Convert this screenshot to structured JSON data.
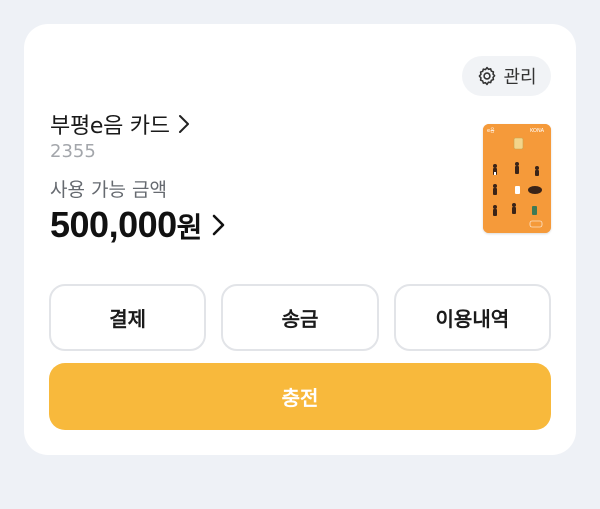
{
  "card": {
    "manage_label": "관리",
    "title": "부평e음 카드",
    "number": "2355",
    "balance_label": "사용 가능 금액",
    "balance_amount": "500,000",
    "balance_unit": "원"
  },
  "card_image": {
    "brand_left": "e음",
    "brand_right": "KONA"
  },
  "actions": {
    "pay": "결제",
    "transfer": "송금",
    "history": "이용내역",
    "charge": "충전"
  },
  "colors": {
    "background": "#eef1f6",
    "accent": "#f8b93c",
    "card_orange": "#f59a3a"
  },
  "icons": [
    "gear-icon",
    "chevron-right-icon"
  ]
}
